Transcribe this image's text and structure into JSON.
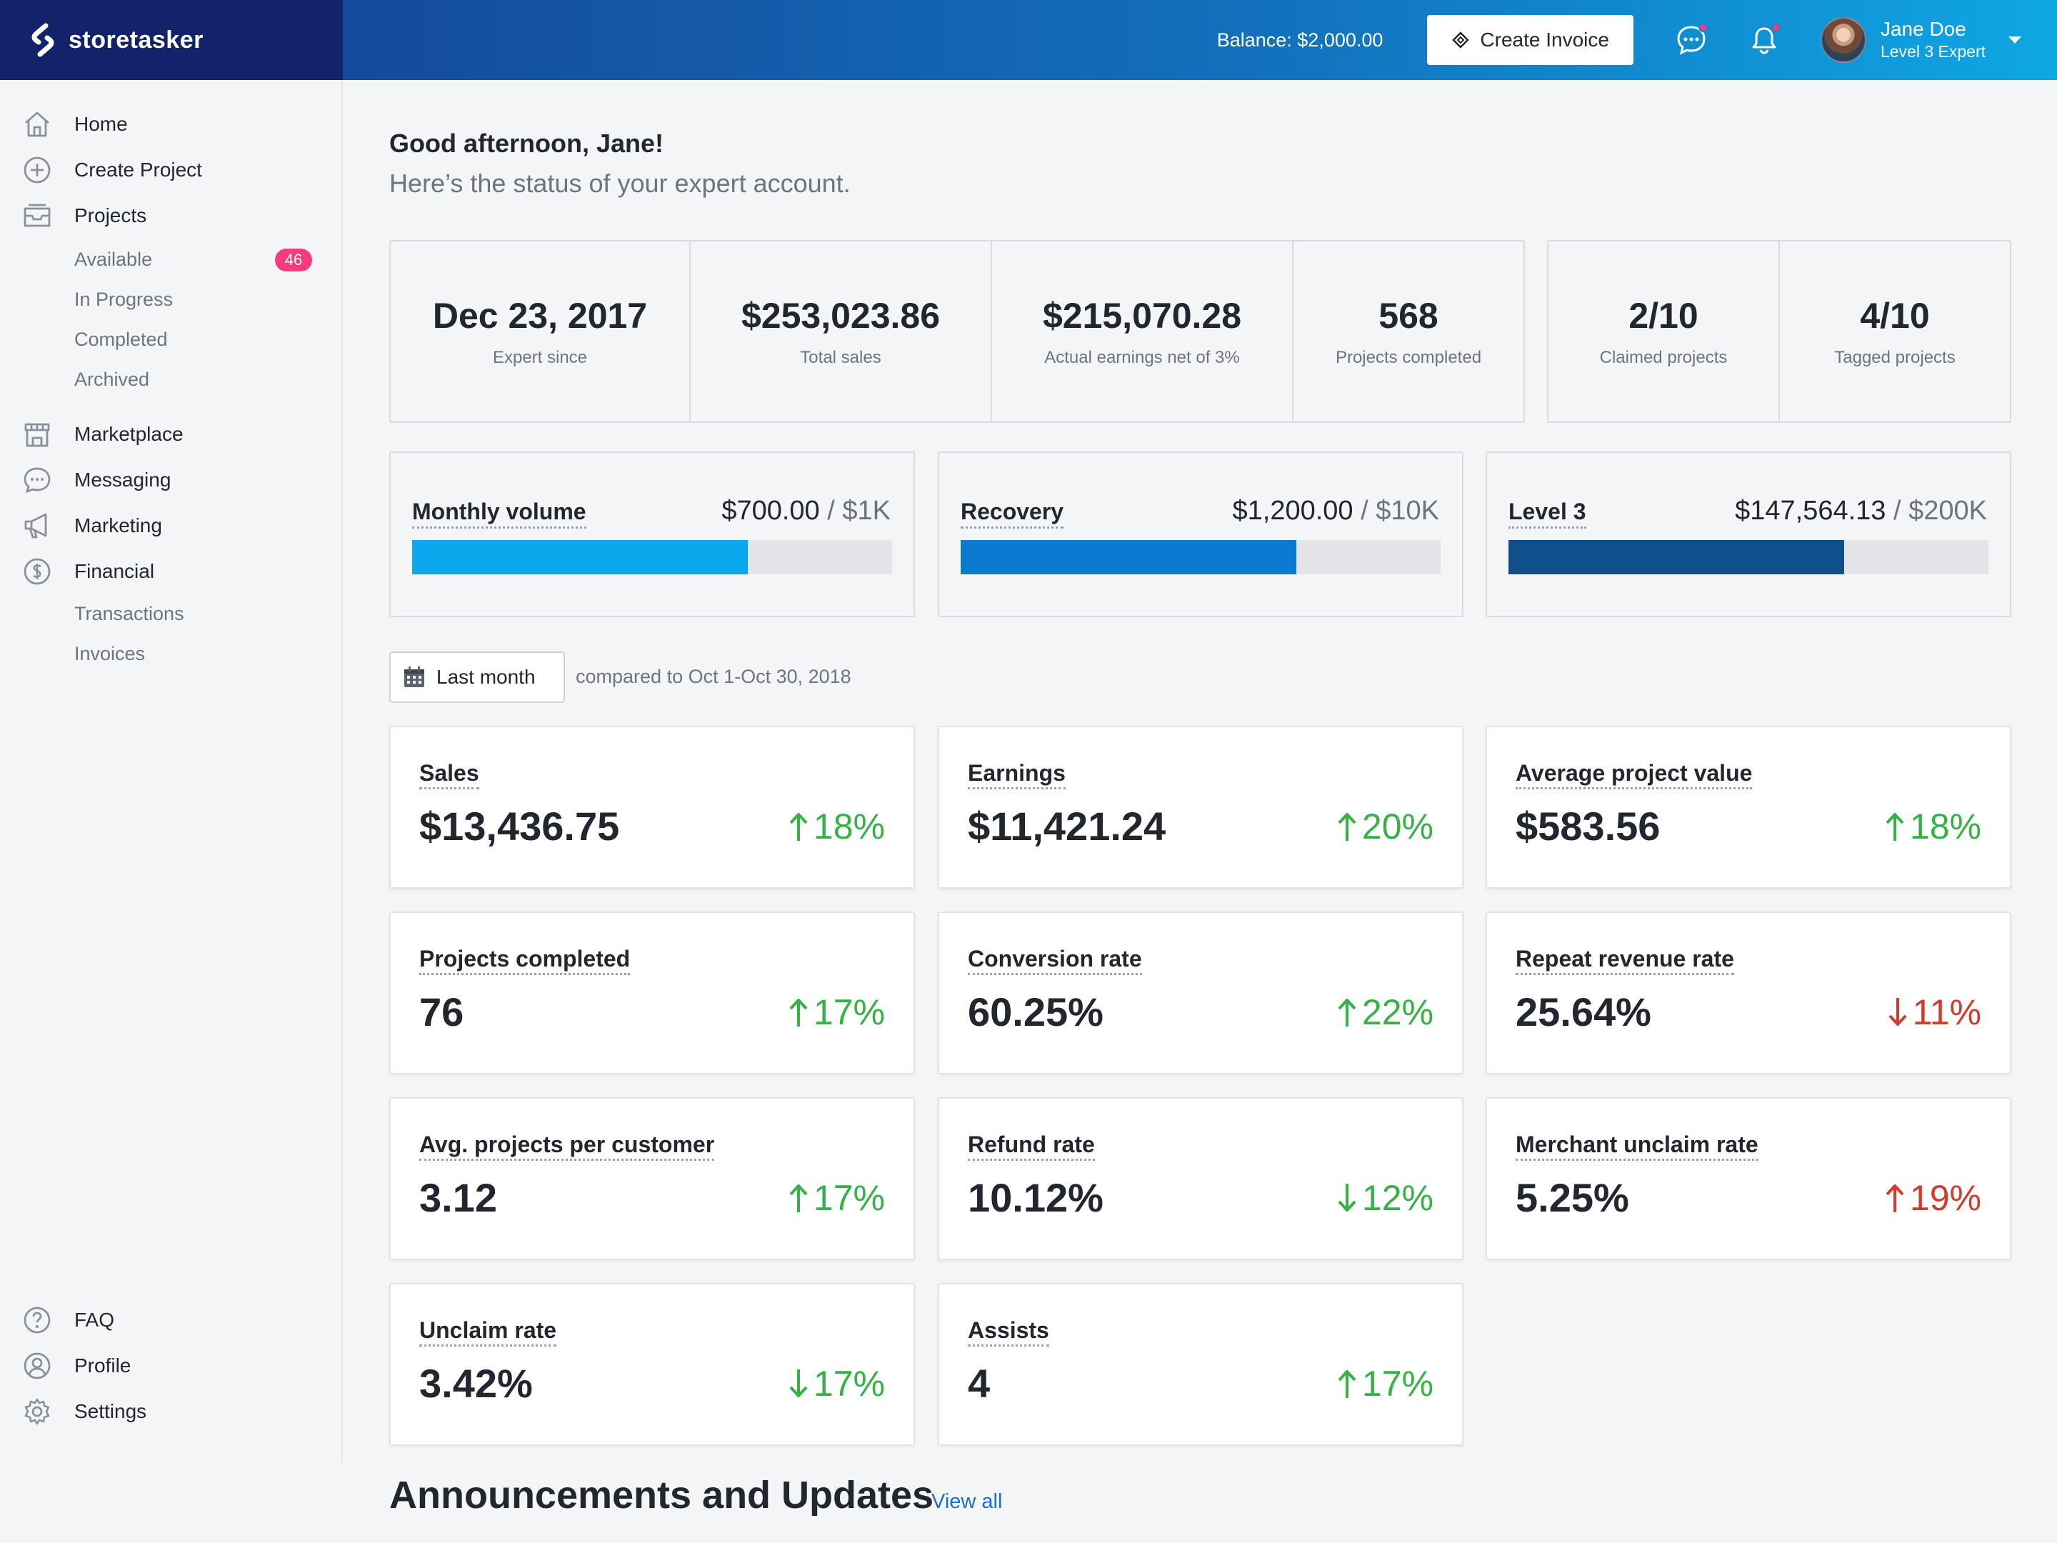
{
  "brand": {
    "name": "storetasker"
  },
  "topnav": {
    "balance": "Balance: $2,000.00",
    "create_invoice": "Create Invoice",
    "user_name": "Jane Doe",
    "user_level": "Level 3 Expert"
  },
  "sidebar": {
    "items": [
      {
        "label": "Home",
        "icon": "home-icon"
      },
      {
        "label": "Create Project",
        "icon": "plus-circle-icon"
      },
      {
        "label": "Projects",
        "icon": "inbox-icon"
      },
      {
        "label": "Marketplace",
        "icon": "store-icon"
      },
      {
        "label": "Messaging",
        "icon": "chat-icon"
      },
      {
        "label": "Marketing",
        "icon": "megaphone-icon"
      },
      {
        "label": "Financial",
        "icon": "dollar-icon"
      },
      {
        "label": "FAQ",
        "icon": "question-icon"
      },
      {
        "label": "Profile",
        "icon": "user-circle-icon"
      },
      {
        "label": "Settings",
        "icon": "gear-icon"
      }
    ],
    "projects_sub": [
      {
        "label": "Available",
        "badge": "46"
      },
      {
        "label": "In Progress"
      },
      {
        "label": "Completed"
      },
      {
        "label": "Archived"
      }
    ],
    "financial_sub": [
      {
        "label": "Transactions"
      },
      {
        "label": "Invoices"
      }
    ]
  },
  "greeting": {
    "title": "Good afternoon, Jane!",
    "subtitle": "Here’s the status of your expert account."
  },
  "stats": [
    {
      "value": "Dec 23, 2017",
      "label": "Expert since"
    },
    {
      "value": "$253,023.86",
      "label": "Total sales"
    },
    {
      "value": "$215,070.28",
      "label": "Actual earnings net of 3%"
    },
    {
      "value": "568",
      "label": "Projects completed"
    }
  ],
  "stats2": [
    {
      "value": "2/10",
      "label": "Claimed projects"
    },
    {
      "value": "4/10",
      "label": "Tagged projects"
    }
  ],
  "progress": [
    {
      "label": "Monthly volume",
      "value": "$700.00",
      "max": " / $1K",
      "fraction": 0.7,
      "color": "#0ba8ee"
    },
    {
      "label": "Recovery",
      "value": "$1,200.00",
      "max": " / $10K",
      "fraction": 0.7,
      "color": "#0a7bd1"
    },
    {
      "label": "Level 3",
      "value": "$147,564.13",
      "max": " / $200K",
      "fraction": 0.7,
      "color": "#0e4f8c"
    }
  ],
  "period": {
    "button": "Last month",
    "compare": "compared to Oct 1-Oct 30, 2018"
  },
  "metrics": [
    {
      "label": "Sales",
      "value": "$13,436.75",
      "change": "18%",
      "direction": "up",
      "tone": "good"
    },
    {
      "label": "Earnings",
      "value": "$11,421.24",
      "change": "20%",
      "direction": "up",
      "tone": "good"
    },
    {
      "label": "Average project value",
      "value": "$583.56",
      "change": "18%",
      "direction": "up",
      "tone": "good"
    },
    {
      "label": "Projects completed",
      "value": "76",
      "change": "17%",
      "direction": "up",
      "tone": "good"
    },
    {
      "label": "Conversion rate",
      "value": "60.25%",
      "change": "22%",
      "direction": "up",
      "tone": "good"
    },
    {
      "label": "Repeat revenue rate",
      "value": "25.64%",
      "change": "11%",
      "direction": "down",
      "tone": "bad"
    },
    {
      "label": "Avg. projects per customer",
      "value": "3.12",
      "change": "17%",
      "direction": "up",
      "tone": "good"
    },
    {
      "label": "Refund rate",
      "value": "10.12%",
      "change": "12%",
      "direction": "down",
      "tone": "good"
    },
    {
      "label": "Merchant unclaim rate",
      "value": "5.25%",
      "change": "19%",
      "direction": "up",
      "tone": "bad"
    },
    {
      "label": "Unclaim rate",
      "value": "3.42%",
      "change": "17%",
      "direction": "down",
      "tone": "good"
    },
    {
      "label": "Assists",
      "value": "4",
      "change": "17%",
      "direction": "up",
      "tone": "good"
    }
  ],
  "announcements": {
    "title": "Announcements and Updates",
    "link": "View all"
  },
  "colors": {
    "brand_dark": "#13236b",
    "gradient_start": "#154a9b",
    "gradient_end": "#0fa6e4",
    "badge": "#f53b7d",
    "positive": "#34b344",
    "negative": "#d33a2c",
    "link": "#1b6fc4"
  }
}
